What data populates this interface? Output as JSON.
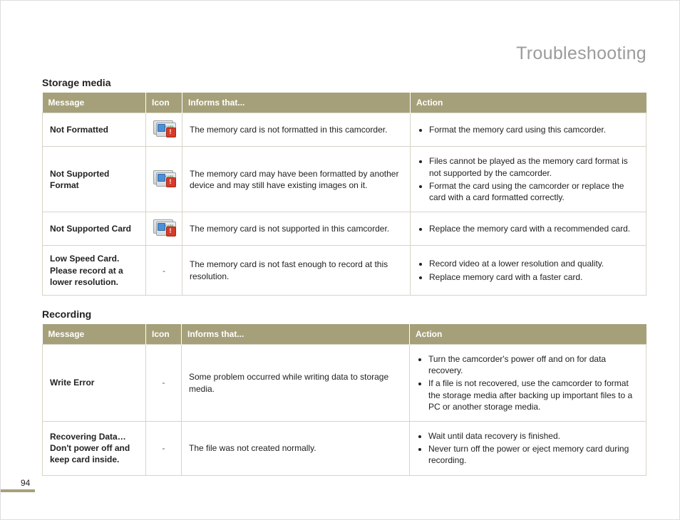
{
  "page": {
    "title": "Troubleshooting",
    "number": "94"
  },
  "headers": {
    "message": "Message",
    "icon": "Icon",
    "informs": "Informs that...",
    "action": "Action"
  },
  "sections": [
    {
      "title": "Storage media",
      "rows": [
        {
          "message": "Not Formatted",
          "icon_type": "card-warn",
          "informs": "The memory card is not formatted in this camcorder.",
          "actions": [
            "Format the memory card using this camcorder."
          ]
        },
        {
          "message": "Not Supported Format",
          "icon_type": "card-warn",
          "informs": "The memory card may have been formatted by another device and may still have existing images on it.",
          "actions": [
            "Files cannot be played as the memory card format is not supported by the camcorder.",
            "Format the card using the camcorder or replace the card with a card formatted correctly."
          ]
        },
        {
          "message": "Not Supported Card",
          "icon_type": "card-warn",
          "informs": "The memory card is not supported in this camcorder.",
          "actions": [
            "Replace the memory card with a recommended card."
          ]
        },
        {
          "message": "Low Speed Card. Please record at a lower resolution.",
          "icon_type": "dash",
          "informs": "The memory card is not fast enough to record at this resolution.",
          "actions": [
            "Record video at a lower resolution and quality.",
            "Replace memory card with a faster card."
          ]
        }
      ]
    },
    {
      "title": "Recording",
      "rows": [
        {
          "message": "Write Error",
          "icon_type": "dash",
          "informs": "Some problem occurred while writing data to storage media.",
          "actions": [
            "Turn the camcorder's power off and on for data recovery.",
            "If a file is not recovered, use the camcorder to format the storage media after backing up important files to a PC or another storage media."
          ]
        },
        {
          "message": "Recovering Data… Don't power off and keep card inside.",
          "icon_type": "dash",
          "informs": "The file was not created normally.",
          "actions": [
            "Wait until data recovery is finished.",
            "Never turn off the power or eject memory card during recording."
          ]
        }
      ]
    }
  ]
}
